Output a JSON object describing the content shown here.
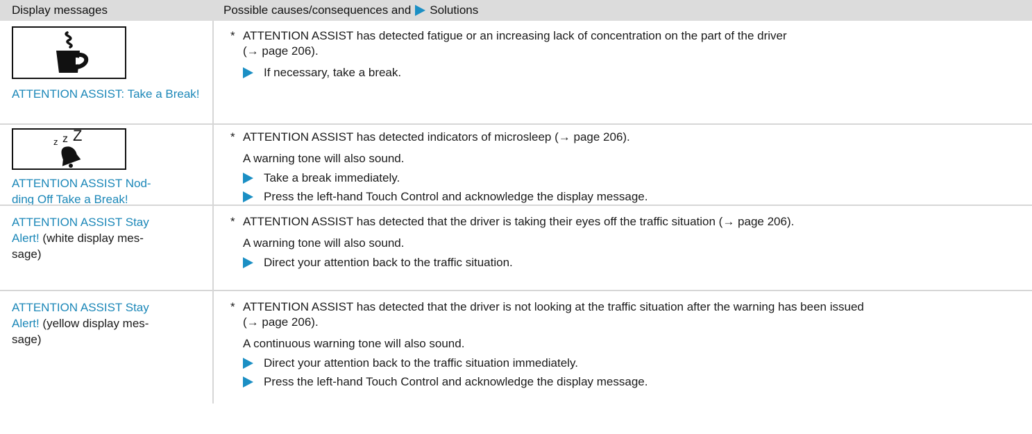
{
  "header": {
    "col1": "Display messages",
    "col2_prefix": "Possible causes/consequences and",
    "col2_suffix": "Solutions"
  },
  "rows": [
    {
      "message": "ATTENTION ASSIST: Take a Break!",
      "icon": "coffee-cup-icon",
      "cause": "ATTENTION ASSIST has detected fatigue or an increasing lack of concentration on the part of the driver",
      "cause_ref": "(→ page 206).",
      "solutions": [
        "If necessary, take a break."
      ]
    },
    {
      "message_line1": "ATTENTION ASSIST Nod-",
      "message_line2": "ding Off Take a Break!",
      "icon": "sleeping-bell-icon",
      "icon_text": "z z Z",
      "cause": "ATTENTION ASSIST has detected indicators of microsleep (→ page 206).",
      "note": "A warning tone will also sound.",
      "solutions": [
        "Take a break immediately.",
        "Press the left-hand Touch Control and acknowledge the display message."
      ]
    },
    {
      "message_line1": "ATTENTION ASSIST Stay",
      "message_line2_blue": "Alert!",
      "message_line2_plain": " (white display mes-",
      "message_line3": "sage)",
      "cause": "ATTENTION ASSIST has detected that the driver is taking their eyes off the traffic situation (→ page 206).",
      "note": "A warning tone will also sound.",
      "solutions": [
        "Direct your attention back to the traffic situation."
      ]
    },
    {
      "message_line1": "ATTENTION ASSIST Stay",
      "message_line2_blue": "Alert!",
      "message_line2_plain": " (yellow display mes-",
      "message_line3": "sage)",
      "cause": "ATTENTION ASSIST has detected that the driver is not looking at the traffic situation after the warning has been issued",
      "cause_ref": "(→ page 206).",
      "note": "A continuous warning tone will also sound.",
      "solutions": [
        "Direct your attention back to the traffic situation immediately.",
        "Press the left-hand Touch Control and acknowledge the display message."
      ]
    }
  ],
  "colors": {
    "accent": "#1b8fc4",
    "link": "#1b87b8",
    "header_bg": "#dcdcdc",
    "divider": "#d6d6d6"
  }
}
